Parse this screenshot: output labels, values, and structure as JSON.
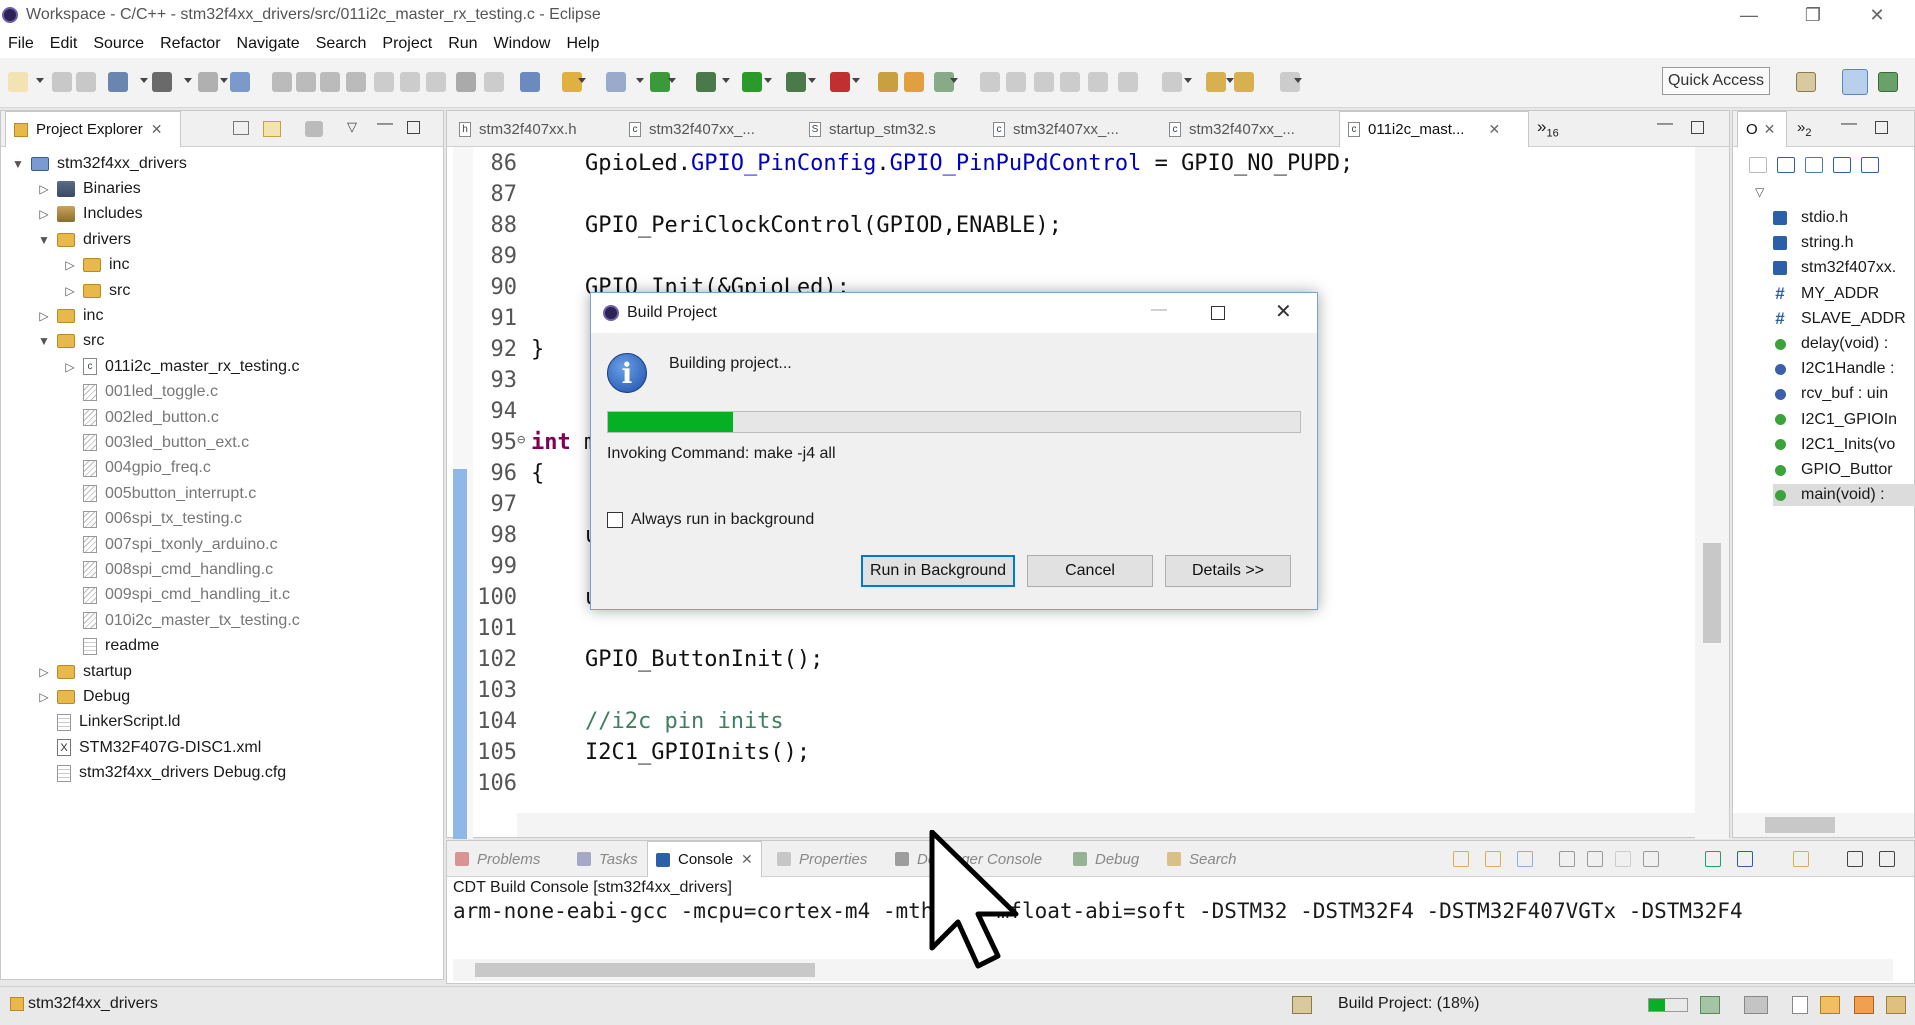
{
  "window": {
    "title": "Workspace - C/C++ - stm32f4xx_drivers/src/011i2c_master_rx_testing.c - Eclipse",
    "minimize": "—",
    "restore": "❐",
    "close": "✕"
  },
  "menu": [
    "File",
    "Edit",
    "Source",
    "Refactor",
    "Navigate",
    "Search",
    "Project",
    "Run",
    "Window",
    "Help"
  ],
  "toolbar": {
    "quick_access": "Quick Access"
  },
  "project_explorer": {
    "tab_label": "Project Explorer",
    "tree": [
      {
        "label": "stm32f4xx_drivers",
        "icon": "project-folder-icon",
        "arrow": "▼",
        "indent": 0
      },
      {
        "label": "Binaries",
        "icon": "binaries-icon",
        "arrow": "▷",
        "indent": 1
      },
      {
        "label": "Includes",
        "icon": "includes-icon",
        "arrow": "▷",
        "indent": 1
      },
      {
        "label": "drivers",
        "icon": "folder-icon",
        "arrow": "▼",
        "indent": 1
      },
      {
        "label": "inc",
        "icon": "folder-icon",
        "arrow": "▷",
        "indent": 2
      },
      {
        "label": "src",
        "icon": "folder-icon",
        "arrow": "▷",
        "indent": 2
      },
      {
        "label": "inc",
        "icon": "folder-icon",
        "arrow": "▷",
        "indent": 1
      },
      {
        "label": "src",
        "icon": "folder-icon",
        "arrow": "▼",
        "indent": 1
      },
      {
        "label": "011i2c_master_rx_testing.c",
        "icon": "c-file-icon",
        "arrow": "▷",
        "indent": 2
      },
      {
        "label": "001led_toggle.c",
        "icon": "excluded-file-icon",
        "arrow": "",
        "indent": 2,
        "dim": true
      },
      {
        "label": "002led_button.c",
        "icon": "excluded-file-icon",
        "arrow": "",
        "indent": 2,
        "dim": true
      },
      {
        "label": "003led_button_ext.c",
        "icon": "excluded-file-icon",
        "arrow": "",
        "indent": 2,
        "dim": true
      },
      {
        "label": "004gpio_freq.c",
        "icon": "excluded-file-icon",
        "arrow": "",
        "indent": 2,
        "dim": true
      },
      {
        "label": "005button_interrupt.c",
        "icon": "excluded-file-icon",
        "arrow": "",
        "indent": 2,
        "dim": true
      },
      {
        "label": "006spi_tx_testing.c",
        "icon": "excluded-file-icon",
        "arrow": "",
        "indent": 2,
        "dim": true
      },
      {
        "label": "007spi_txonly_arduino.c",
        "icon": "excluded-file-icon",
        "arrow": "",
        "indent": 2,
        "dim": true
      },
      {
        "label": "008spi_cmd_handling.c",
        "icon": "excluded-file-icon",
        "arrow": "",
        "indent": 2,
        "dim": true
      },
      {
        "label": "009spi_cmd_handling_it.c",
        "icon": "excluded-file-icon",
        "arrow": "",
        "indent": 2,
        "dim": true
      },
      {
        "label": "010i2c_master_tx_testing.c",
        "icon": "excluded-file-icon",
        "arrow": "",
        "indent": 2,
        "dim": true
      },
      {
        "label": "readme",
        "icon": "text-file-icon",
        "arrow": "",
        "indent": 2
      },
      {
        "label": "startup",
        "icon": "folder-icon",
        "arrow": "▷",
        "indent": 1
      },
      {
        "label": "Debug",
        "icon": "folder-icon",
        "arrow": "▷",
        "indent": 1
      },
      {
        "label": "LinkerScript.ld",
        "icon": "text-file-icon",
        "arrow": "",
        "indent": 1
      },
      {
        "label": "STM32F407G-DISC1.xml",
        "icon": "xml-file-icon",
        "arrow": "",
        "indent": 1
      },
      {
        "label": "stm32f4xx_drivers Debug.cfg",
        "icon": "text-file-icon",
        "arrow": "",
        "indent": 1
      }
    ]
  },
  "editor": {
    "tabs": [
      {
        "label": "stm32f407xx.h",
        "active": false
      },
      {
        "label": "stm32f407xx_...",
        "active": false
      },
      {
        "label": "startup_stm32.s",
        "active": false
      },
      {
        "label": "stm32f407xx_...",
        "active": false
      },
      {
        "label": "stm32f407xx_...",
        "active": false
      },
      {
        "label": "011i2c_mast...",
        "active": true
      }
    ],
    "overflow_label": "»",
    "overflow_count": "16",
    "lines": [
      {
        "n": "86",
        "html": "GpioLed.<span class='fld'>GPIO_PinConfig</span>.<span class='fld'>GPIO_PinPuPdControl</span> = GPIO_NO_PUPD;",
        "indent": 1
      },
      {
        "n": "87",
        "html": "",
        "indent": 1
      },
      {
        "n": "88",
        "html": "GPIO_PeriClockControl(GPIOD,ENABLE);",
        "indent": 1
      },
      {
        "n": "89",
        "html": "",
        "indent": 1
      },
      {
        "n": "90",
        "html": "GPIO_Init(&amp;GpioLed);",
        "indent": 1
      },
      {
        "n": "91",
        "html": "",
        "indent": 1
      },
      {
        "n": "92",
        "html": "}",
        "indent": 0
      },
      {
        "n": "93",
        "html": "",
        "indent": 0
      },
      {
        "n": "94",
        "html": "",
        "indent": 0
      },
      {
        "n": "95",
        "html": "<span class='kw'>int</span> main(<span class='kw'>void</span>)",
        "indent": 0,
        "fold": "⊖"
      },
      {
        "n": "96",
        "html": "{",
        "indent": 0
      },
      {
        "n": "97",
        "html": "",
        "indent": 1
      },
      {
        "n": "98",
        "html": "uint8_t i;",
        "indent": 1
      },
      {
        "n": "99",
        "html": "",
        "indent": 1
      },
      {
        "n": "100",
        "html": "uint8_t len;",
        "indent": 1
      },
      {
        "n": "101",
        "html": "",
        "indent": 1
      },
      {
        "n": "102",
        "html": "GPIO_ButtonInit();",
        "indent": 1
      },
      {
        "n": "103",
        "html": "",
        "indent": 1
      },
      {
        "n": "104",
        "html": "<span class='cmt'>//i2c pin inits</span>",
        "indent": 1
      },
      {
        "n": "105",
        "html": "I2C1_GPIOInits();",
        "indent": 1
      },
      {
        "n": "106",
        "html": "",
        "indent": 1
      }
    ]
  },
  "outline": {
    "tab_label": "O",
    "overflow_count": "2",
    "items": [
      {
        "label": "stdio.h",
        "icon": "h"
      },
      {
        "label": "string.h",
        "icon": "h"
      },
      {
        "label": "stm32f407xx.",
        "icon": "h"
      },
      {
        "label": "MY_ADDR",
        "icon": "hash"
      },
      {
        "label": "SLAVE_ADDR",
        "icon": "hash"
      },
      {
        "label": "delay(void) :",
        "icon": "dot-green"
      },
      {
        "label": "I2C1Handle :",
        "icon": "dot-blue"
      },
      {
        "label": "rcv_buf : uin",
        "icon": "dot-blue"
      },
      {
        "label": "I2C1_GPIOIn",
        "icon": "dot-green"
      },
      {
        "label": "I2C1_Inits(vo",
        "icon": "dot-green"
      },
      {
        "label": "GPIO_Buttor",
        "icon": "dot-green"
      },
      {
        "label": "main(void) :",
        "icon": "dot-green",
        "selected": true
      }
    ]
  },
  "dialog": {
    "title": "Build Project",
    "message": "Building project...",
    "progress": 0.18,
    "command": "Invoking Command: make -j4 all",
    "checkbox_label": "Always run in background",
    "buttons": {
      "run_bg": "Run in Background",
      "cancel": "Cancel",
      "details": "Details >>"
    }
  },
  "bottom_panel": {
    "tabs": [
      "Problems",
      "Tasks",
      "Console",
      "Properties",
      "Debugger Console",
      "Debug",
      "Search"
    ],
    "active_tab": "Console",
    "console_title": "CDT Build Console [stm32f4xx_drivers]",
    "console_line": "arm-none-eabi-gcc -mcpu=cortex-m4 -mthumb -mfloat-abi=soft -DSTM32 -DSTM32F4 -DSTM32F407VGTx -DSTM32F4"
  },
  "status": {
    "left": "stm32f4xx_drivers",
    "build": "Build Project: (18%)"
  },
  "colors": {
    "progress": "#06b025",
    "accent": "#0078d7",
    "keyword": "#7f0055",
    "field": "#0000c0",
    "comment": "#3f7f5f"
  }
}
